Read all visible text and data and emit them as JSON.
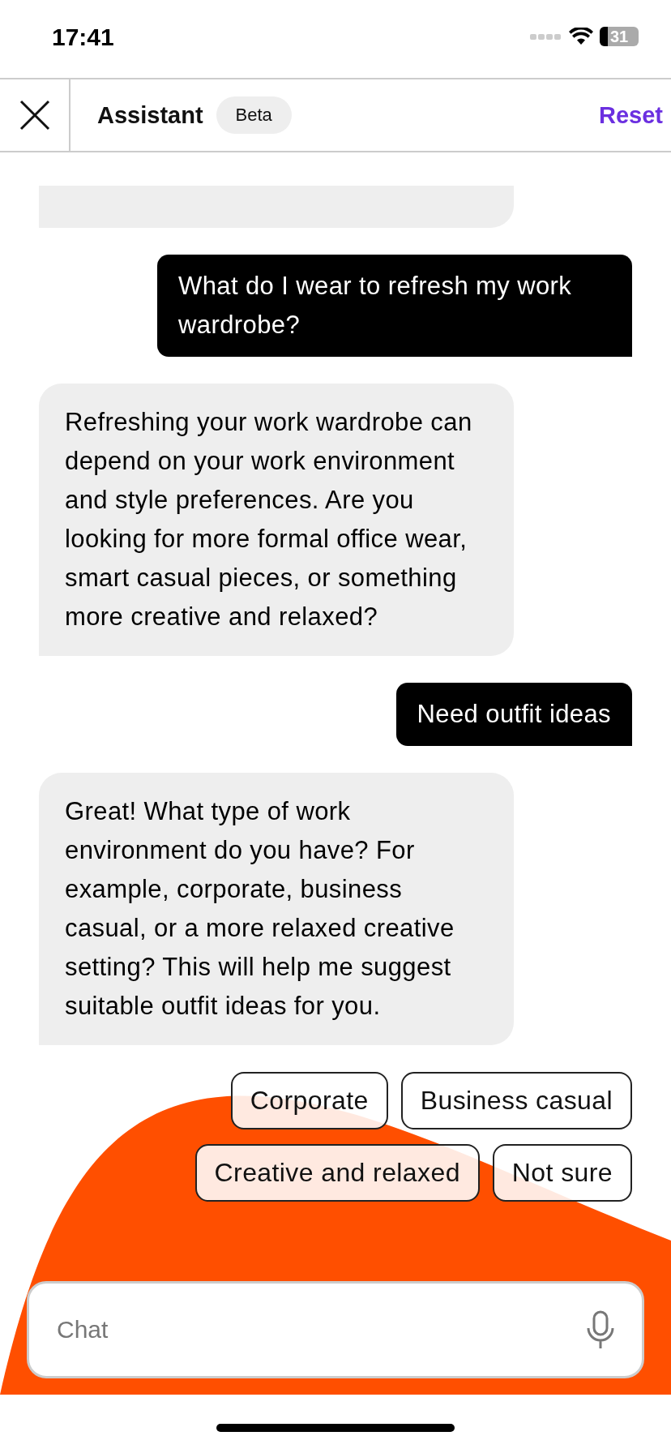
{
  "status_bar": {
    "time": "17:41",
    "battery": "31"
  },
  "header": {
    "title": "Assistant",
    "badge": "Beta",
    "action": "Reset"
  },
  "messages": [
    {
      "kind": "assistant"
    },
    {
      "kind": "user",
      "text": "What do I wear to refresh my work wardrobe?"
    },
    {
      "kind": "assistant",
      "text": "Refreshing your work wardrobe can depend on your work environment and style preferences. Are you looking for more formal office wear, smart casual pieces, or something more creative and relaxed?"
    },
    {
      "kind": "user",
      "text": "Need outfit ideas"
    },
    {
      "kind": "assistant",
      "text": "Great! What type of work environment do you have? For example, corporate, business casual, or a more relaxed creative setting? This will help me suggest suitable outfit ideas for you."
    }
  ],
  "suggestions": [
    [
      "Corporate",
      "Business casual"
    ],
    [
      "Creative and relaxed",
      "Not sure"
    ]
  ],
  "composer": {
    "placeholder": "Chat"
  }
}
